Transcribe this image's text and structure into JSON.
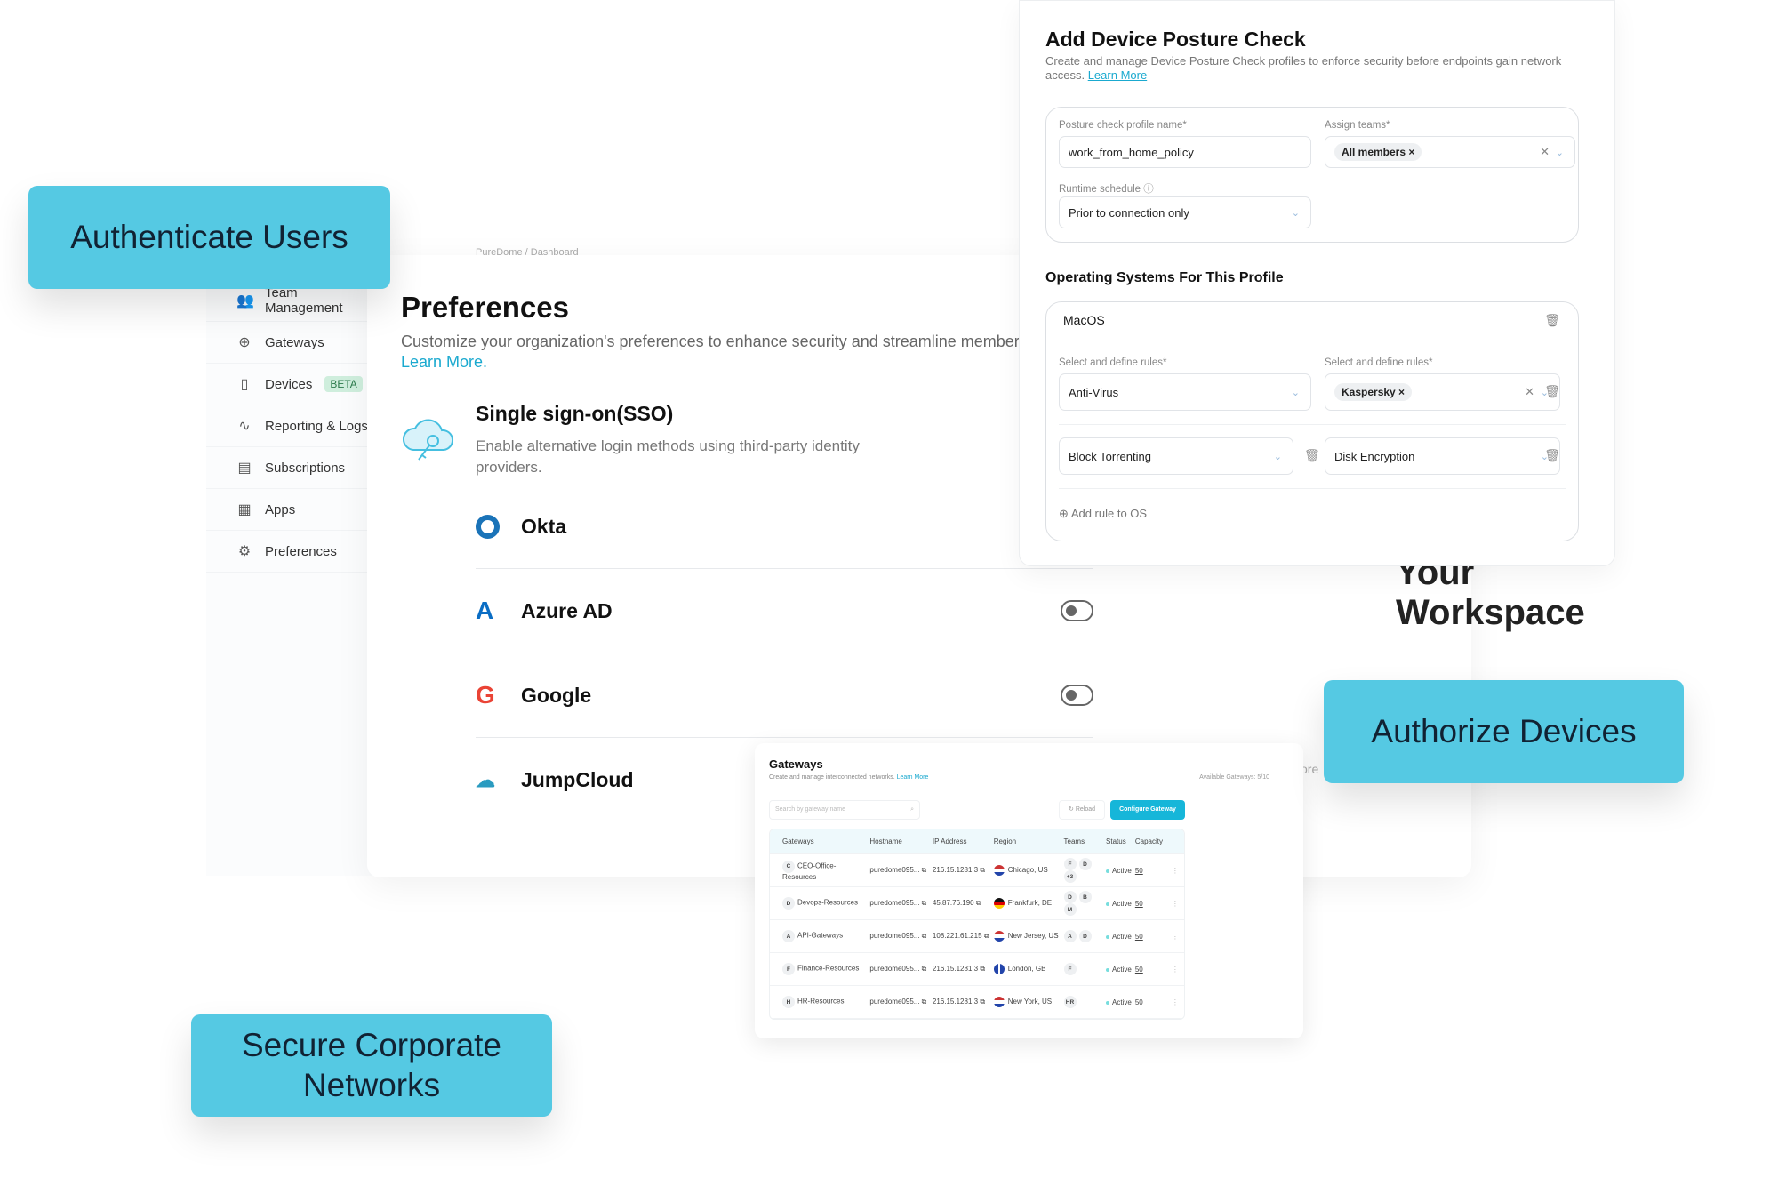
{
  "badges": {
    "authenticate": "Authenticate Users",
    "authorize": "Authorize Devices",
    "secure": "Secure Corporate Networks"
  },
  "colors": {
    "badge": "#55c9e3",
    "accent": "#1aa9cf",
    "okta": "#1a73b8"
  },
  "breadcrumb": [
    "PureDome",
    "Dashboard"
  ],
  "sidebar": {
    "items": [
      {
        "label": "Team Management",
        "icon": "users-icon"
      },
      {
        "label": "Gateways",
        "icon": "globe-icon"
      },
      {
        "label": "Devices",
        "icon": "devices-icon",
        "badge": "BETA"
      },
      {
        "label": "Reporting & Logs",
        "icon": "activity-icon"
      },
      {
        "label": "Subscriptions",
        "icon": "receipt-icon"
      },
      {
        "label": "Apps",
        "icon": "apps-icon"
      },
      {
        "label": "Preferences",
        "icon": "gear-icon"
      }
    ]
  },
  "preferences": {
    "title": "Preferences",
    "description": "Customize your organization's preferences to enhance security and streamline member ma",
    "learn_more": "Learn More.",
    "sso": {
      "title": "Single sign-on(SSO)",
      "description": "Enable alternative login methods using third-party identity providers."
    },
    "providers": [
      {
        "name": "Okta",
        "toggle": null
      },
      {
        "name": "Azure AD",
        "toggle": false
      },
      {
        "name": "Google",
        "toggle": false
      },
      {
        "name": "JumpCloud",
        "toggle": null
      }
    ],
    "workspace_text": "Your Workspace",
    "partial_text": "ore"
  },
  "posture": {
    "title": "Add Device Posture Check",
    "description": "Create and manage Device Posture Check profiles to enforce security before endpoints gain network access.",
    "learn_more": "Learn More",
    "profile_name_label": "Posture check profile name*",
    "profile_name_value": "work_from_home_policy",
    "assign_teams_label": "Assign teams*",
    "assign_teams_chip": "All members",
    "runtime_label": "Runtime schedule",
    "runtime_value": "Prior to connection only",
    "os_section_title": "Operating Systems For This Profile",
    "os_name": "MacOS",
    "rules_label": "Select and define rules*",
    "rule1": "Anti-Virus",
    "rule1_value": "Kaspersky",
    "rule2": "Block Torrenting",
    "rule3": "Disk Encryption",
    "add_rule": "Add rule to OS"
  },
  "gateways": {
    "title": "Gateways",
    "description": "Create and manage interconnected networks.",
    "learn_more": "Learn More",
    "available": "Available Gateways: 5/10",
    "search_placeholder": "Search by gateway name",
    "reload": "Reload",
    "configure": "Configure Gateway",
    "columns": [
      "Gateways",
      "Hostname",
      "IP Address",
      "Region",
      "Teams",
      "Status",
      "Capacity"
    ],
    "rows": [
      {
        "initial": "C",
        "name": "CEO-Office-Resources",
        "host": "puredome095...",
        "ip": "216.15.1281.3",
        "region": "Chicago, US",
        "flag": "us",
        "teams": [
          "F",
          "D",
          "+3"
        ],
        "status": "Active",
        "capacity": "50"
      },
      {
        "initial": "D",
        "name": "Devops-Resources",
        "host": "puredome095...",
        "ip": "45.87.76.190",
        "region": "Frankfurk, DE",
        "flag": "de",
        "teams": [
          "D",
          "B",
          "M"
        ],
        "status": "Active",
        "capacity": "50"
      },
      {
        "initial": "A",
        "name": "API-Gateways",
        "host": "puredome095...",
        "ip": "108.221.61.215",
        "region": "New Jersey, US",
        "flag": "us",
        "teams": [
          "A",
          "D"
        ],
        "status": "Active",
        "capacity": "50"
      },
      {
        "initial": "F",
        "name": "Finance-Resources",
        "host": "puredome095...",
        "ip": "216.15.1281.3",
        "region": "London, GB",
        "flag": "gb",
        "teams": [
          "F"
        ],
        "status": "Active",
        "capacity": "50"
      },
      {
        "initial": "H",
        "name": "HR-Resources",
        "host": "puredome095...",
        "ip": "216.15.1281.3",
        "region": "New York, US",
        "flag": "us",
        "teams": [
          "HR"
        ],
        "status": "Active",
        "capacity": "50"
      }
    ]
  }
}
